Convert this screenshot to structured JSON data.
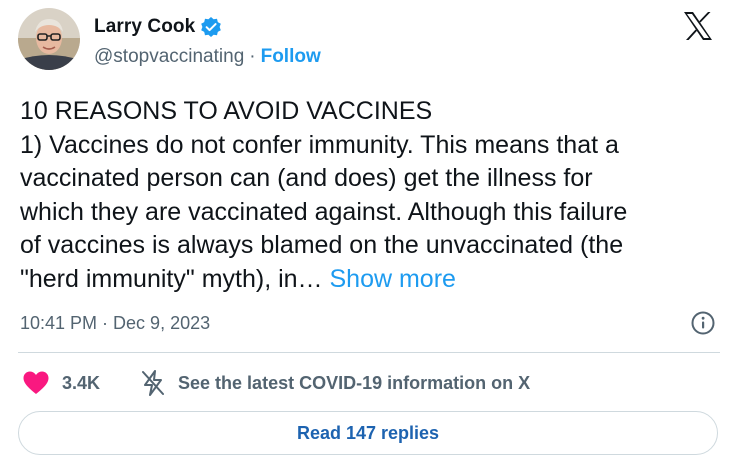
{
  "author": {
    "display_name": "Larry Cook",
    "handle": "@stopvaccinating",
    "separator": "·",
    "follow_label": "Follow",
    "verified": true,
    "avatar_icon": "avatar-photo-man-glasses"
  },
  "brand": {
    "logo_icon": "x-logo-icon"
  },
  "tweet": {
    "lines": [
      "10 REASONS TO AVOID VACCINES",
      "1) Vaccines do not confer immunity. This means that a",
      "vaccinated person can (and does) get the illness for",
      "which they are vaccinated against. Although this failure",
      "of vaccines is always blamed on the unvaccinated (the",
      "\"herd immunity\" myth), in…"
    ],
    "show_more_label": "Show more",
    "time": "10:41 PM",
    "meta_separator": "·",
    "date": "Dec 9, 2023"
  },
  "engagement": {
    "like_count": "3.4K",
    "covid_notice": "See the latest COVID-19 information on X"
  },
  "replies": {
    "button_label": "Read 147 replies"
  },
  "colors": {
    "accent": "#1d9bf0",
    "text": "#0f1419",
    "muted": "#536471",
    "heart": "#f91880",
    "border": "#cfd9de"
  }
}
